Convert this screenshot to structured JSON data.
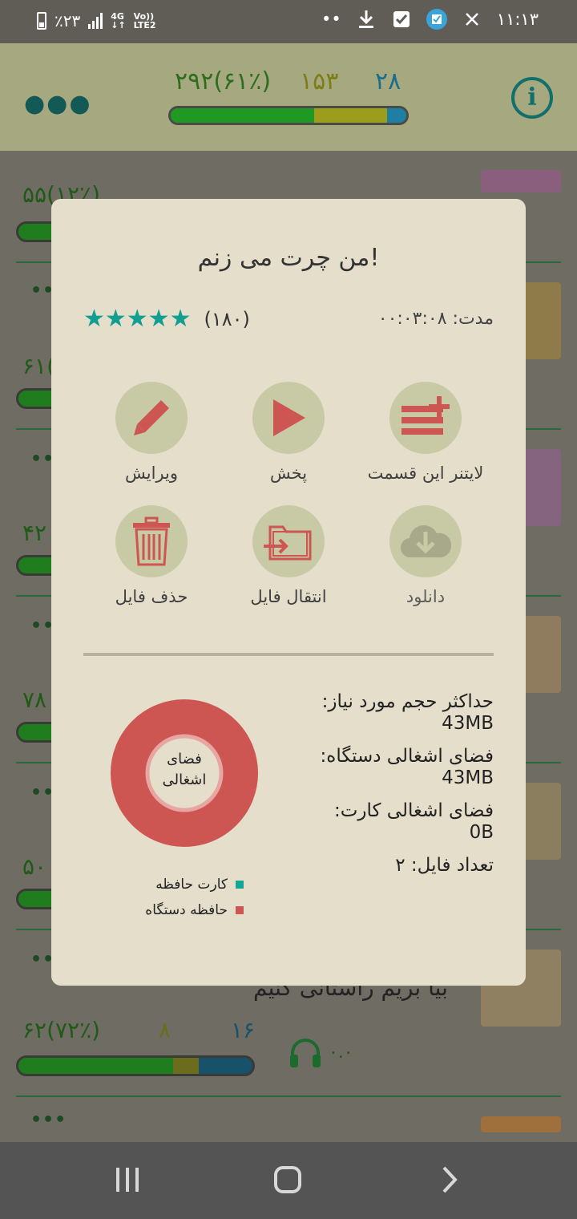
{
  "status_bar": {
    "battery": "٪۲۳",
    "network": "4G",
    "volte": "Vo))",
    "lte": "LTE2",
    "dots": "••",
    "time": "۱۱:۱۳"
  },
  "header": {
    "menu_icon": "more-dots-icon",
    "info_icon": "info-icon",
    "info_glyph": "i",
    "stats": {
      "green": "۲۹۲(۶۱٪)",
      "yellow": "۱۵۳",
      "blue": "۲۸"
    },
    "progress": {
      "green": 0.61,
      "yellow": 0.31,
      "blue": 0.08
    }
  },
  "background_list": {
    "dots": "•••",
    "numbers": [
      "۵۵(۱۲٪)",
      "۶۱(",
      "۴۲",
      "۷۸",
      "۵۰"
    ],
    "last_row": {
      "title": "بیا بریم راستانی کنیم",
      "stats": {
        "green": "۶۲(۷۲٪)",
        "yellow": "۸",
        "blue": "۱۶"
      },
      "progress": {
        "green": 0.66,
        "yellow": 0.11,
        "blue": 0.23
      },
      "headphones_value": "۰.۰"
    }
  },
  "dialog": {
    "title": "من چرت می زنم!",
    "duration_label": "مدت:",
    "duration_value": "۰۰:۰۳:۰۸",
    "stars": "★★★★★",
    "rating_count": "(۱۸۰)",
    "actions": [
      {
        "label": "لایتنر این قسمت",
        "icon": "add-to-list-icon"
      },
      {
        "label": "پخش",
        "icon": "play-icon"
      },
      {
        "label": "ویرایش",
        "icon": "pencil-icon"
      },
      {
        "label": "دانلود",
        "icon": "download-cloud-icon"
      },
      {
        "label": "انتقال فایل",
        "icon": "move-folder-icon"
      },
      {
        "label": "حذف فایل",
        "icon": "trash-icon"
      }
    ],
    "storage": {
      "max_label": "حداکثر حجم مورد نیاز:",
      "max_value": "43MB",
      "device_label": "فضای اشغالی دستگاه:",
      "device_value": "43MB",
      "card_label": "فضای اشغالی کارت:",
      "card_value": "0B",
      "file_count": "تعداد فایل: ۲"
    },
    "chart_data": {
      "type": "pie",
      "center_label_line1": "فضای",
      "center_label_line2": "اشغالی",
      "categories": [
        "کارت حافظه",
        "حافظه دستگاه"
      ],
      "values": [
        0,
        43
      ],
      "colors": [
        "#13a595",
        "#cd5652"
      ]
    }
  },
  "nav": {
    "recents_icon": "recents-icon",
    "home_icon": "home-icon",
    "back_icon": "back-icon"
  }
}
